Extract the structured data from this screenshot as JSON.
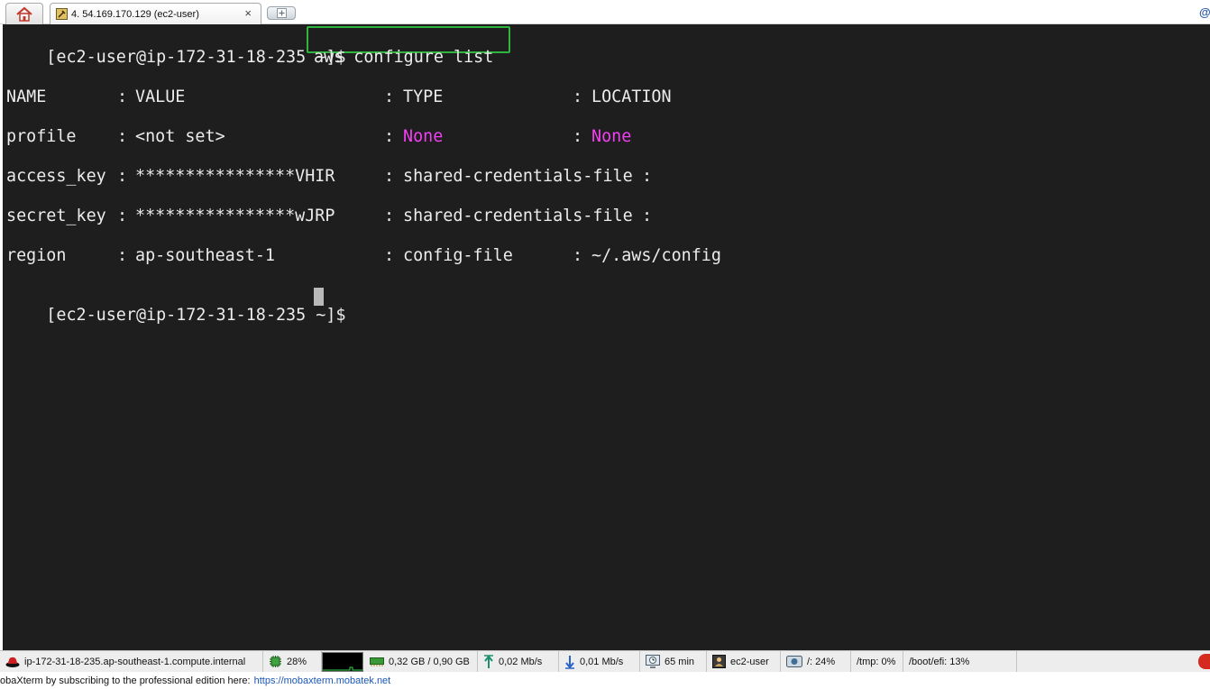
{
  "window": {
    "tab": {
      "label": "4. 54.169.170.129 (ec2-user)",
      "close": "×",
      "icon": "wrench-terminal-icon"
    },
    "home_tab": {
      "icon": "home-icon"
    },
    "new_tab": {
      "icon": "add-tab-icon"
    }
  },
  "terminal": {
    "prompt": "[ec2-user@ip-172-31-18-235 ~]$",
    "command": "aws configure list",
    "header": {
      "name": "NAME",
      "sep": ":",
      "value": "VALUE",
      "type": "TYPE",
      "location": "LOCATION"
    },
    "rows": [
      {
        "name": "profile",
        "value": "<not set>",
        "type": "None",
        "location": "None"
      },
      {
        "name": "access_key",
        "value": "****************VHIR",
        "type": "shared-credentials-file",
        "location": ""
      },
      {
        "name": "secret_key",
        "value": "****************wJRP",
        "type": "shared-credentials-file",
        "location": ""
      },
      {
        "name": "region",
        "value": "ap-southeast-1",
        "type": "config-file",
        "location": "~/.aws/config"
      }
    ],
    "highlight_color": "#f23ff2",
    "box_color": "#2fb53e"
  },
  "statusbar": {
    "host": "ip-172-31-18-235.ap-southeast-1.compute.internal",
    "cpu": "28%",
    "memory": "0,32 GB / 0,90 GB",
    "upload": "0,02 Mb/s",
    "download": "0,01 Mb/s",
    "uptime": "65 min",
    "user": "ec2-user",
    "disk_root": "/: 24%",
    "disk_tmp": "/tmp: 0%",
    "disk_boot": "/boot/efi: 13%"
  },
  "footer": {
    "text": "obaXterm by subscribing to the professional edition here:",
    "link": "https://mobaxterm.mobatek.net"
  }
}
